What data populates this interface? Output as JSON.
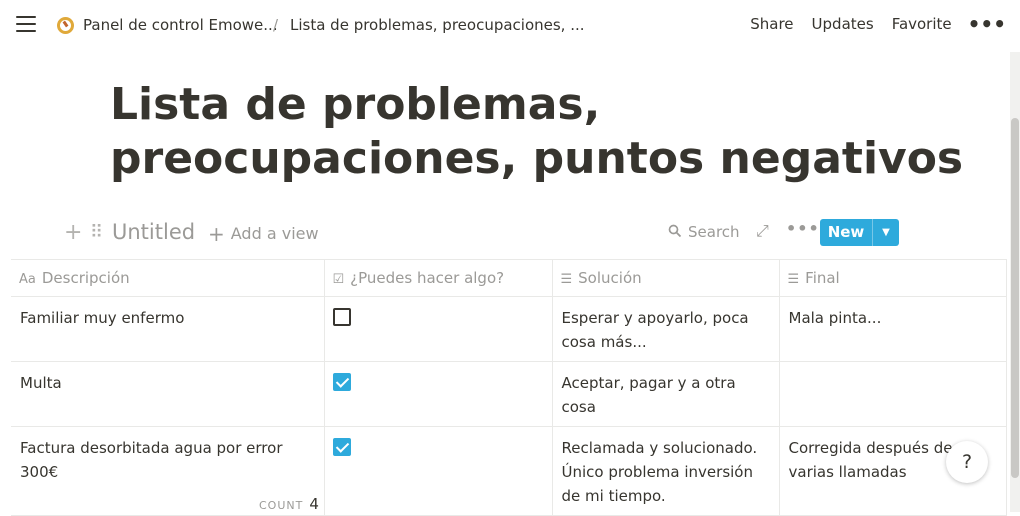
{
  "topbar": {
    "breadcrumb_1": "Panel de control Emowe...",
    "breadcrumb_sep": "/",
    "breadcrumb_2": "Lista de problemas, preocupaciones, ...",
    "share": "Share",
    "updates": "Updates",
    "favorite": "Favorite",
    "more": "•••"
  },
  "page": {
    "title": "Lista de problemas, preocupaciones, puntos negativos"
  },
  "view": {
    "name": "Untitled",
    "add_view": "Add a view",
    "search": "Search",
    "new_label": "New"
  },
  "table": {
    "columns": [
      {
        "label": "Descripción",
        "icon": "Aa"
      },
      {
        "label": "¿Puedes hacer algo?",
        "icon": "checkbox-icon"
      },
      {
        "label": "Solución",
        "icon": "text-lines-icon"
      },
      {
        "label": "Final",
        "icon": "text-lines-icon"
      }
    ],
    "rows": [
      {
        "descripcion": "Familiar muy enfermo",
        "puedes": false,
        "solucion": "Esperar y apoyarlo, poca cosa más...",
        "final": "Mala pinta..."
      },
      {
        "descripcion": "Multa",
        "puedes": true,
        "solucion": "Aceptar, pagar y a otra cosa",
        "final": ""
      },
      {
        "descripcion": "Factura desorbitada agua por error 300€",
        "puedes": true,
        "solucion": "Reclamada y solucionado. Único problema inversión de mi tiempo.",
        "final": "Corregida después de varias llamadas"
      }
    ]
  },
  "footer": {
    "count_label": "COUNT",
    "count_value": "4",
    "help": "?"
  },
  "colors": {
    "accent": "#2eaadc",
    "text": "#37352f",
    "muted": "#9b9a97"
  }
}
